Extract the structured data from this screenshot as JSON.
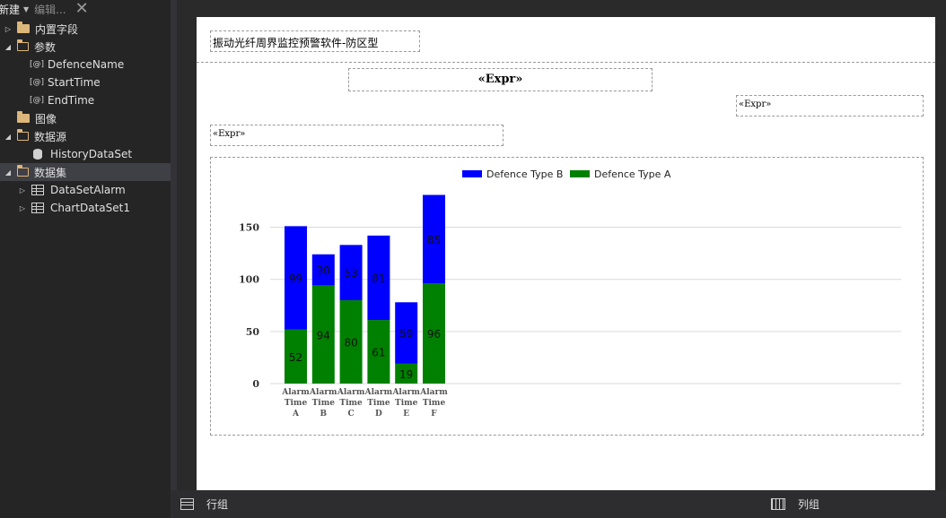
{
  "toolbar": {
    "new_label": "新建",
    "edit_label": "编辑..."
  },
  "tree": {
    "builtin_fields": "内置字段",
    "parameters": "参数",
    "param_items": [
      "DefenceName",
      "StartTime",
      "EndTime"
    ],
    "images": "图像",
    "datasources": "数据源",
    "datasource_items": [
      "HistoryDataSet"
    ],
    "datasets": "数据集",
    "dataset_items": [
      "DataSetAlarm",
      "ChartDataSet1"
    ]
  },
  "report": {
    "header_text": "振动光纤周界监控预警软件-防区型",
    "title_expr": "«Expr»",
    "right_expr": "«Expr»",
    "left_expr": "«Expr»"
  },
  "chart_data": {
    "type": "bar",
    "stacked": true,
    "categories": [
      "Alarm Time A",
      "Alarm Time B",
      "Alarm Time C",
      "Alarm Time D",
      "Alarm Time E",
      "Alarm Time F"
    ],
    "category_lines": [
      [
        "Alarm",
        "Time",
        "A"
      ],
      [
        "Alarm",
        "Time",
        "B"
      ],
      [
        "Alarm",
        "Time",
        "C"
      ],
      [
        "Alarm",
        "Time",
        "D"
      ],
      [
        "Alarm",
        "Time",
        "E"
      ],
      [
        "Alarm",
        "Time",
        "F"
      ]
    ],
    "series": [
      {
        "name": "Defence Type A",
        "color": "#008000",
        "values": [
          52,
          94,
          80,
          61,
          19,
          96
        ]
      },
      {
        "name": "Defence Type B",
        "color": "#0000ff",
        "values": [
          99,
          30,
          53,
          81,
          59,
          85
        ]
      }
    ],
    "legend_order": [
      "Defence Type B",
      "Defence Type A"
    ],
    "legend_position": "top-center",
    "yticks": [
      0,
      50,
      100,
      150
    ],
    "ylim": [
      0,
      185
    ],
    "grid": true
  },
  "bottom_bar": {
    "row_group": "行组",
    "column_group": "列组"
  }
}
